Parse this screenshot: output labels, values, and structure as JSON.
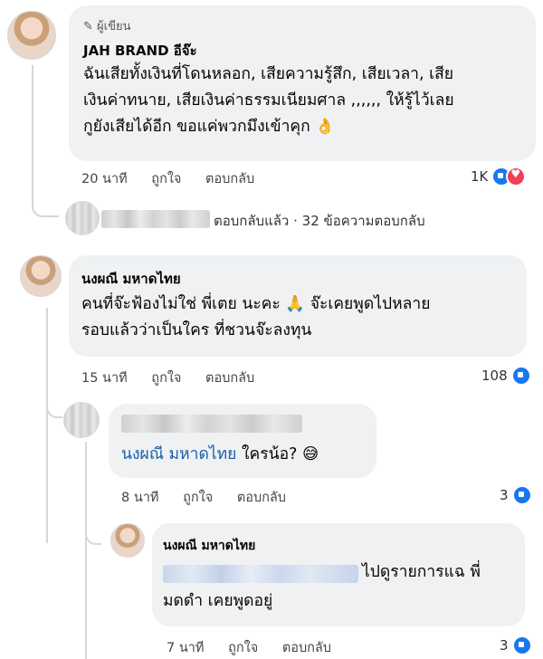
{
  "comments": [
    {
      "badge": "ผู้เขียน",
      "author": "JAH BRAND อีจ๊ะ",
      "lines": [
        "ฉันเสียทั้งเงินที่โดนหลอก, เสียความรู้สึก, เสียเวลา, เสีย",
        "เงินค่าทนาย, เสียเงินค่าธรรมเนียมศาล ,,,,,, ให้รู้ไว้เลย",
        "กูยังเสียได้อีก ขอแค่พวกมึงเข้าคุก 👌"
      ],
      "time": "20 นาที",
      "like": "ถูกใจ",
      "reply": "ตอบกลับ",
      "reactions": "1K"
    },
    {
      "author": "นงผณี มหาดไทย",
      "lines": [
        "คนที่จ๊ะฟ้องไม่ใช่ พี่เตย นะคะ 🙏 จ๊ะเคยพูดไปหลาย",
        "รอบแล้วว่าเป็นใคร ที่ชวนจ๊ะลงทุน"
      ],
      "time": "15 นาที",
      "like": "ถูกใจ",
      "reply": "ตอบกลับ",
      "reactions": "108"
    },
    {
      "mention": "นงผณี มหาดไทย",
      "text": "ใครน้อ? 😅",
      "time": "8 นาที",
      "like": "ถูกใจ",
      "reply": "ตอบกลับ",
      "reactions": "3"
    },
    {
      "author": "นงผณี มหาดไทย",
      "line1": "ไปดูรายการแฉ พี่",
      "line2": "มดดำ เคยพูดอยู่",
      "time": "7 นาที",
      "like": "ถูกใจ",
      "reply": "ตอบกลับ",
      "reactions": "3"
    }
  ],
  "replies_summary": "ตอบกลับแล้ว · 32 ข้อความตอบกลับ",
  "colors": {
    "like": "#1877f2",
    "love": "#f33e58",
    "bubble": "#eff1f3",
    "mention": "#1a5ea8"
  }
}
